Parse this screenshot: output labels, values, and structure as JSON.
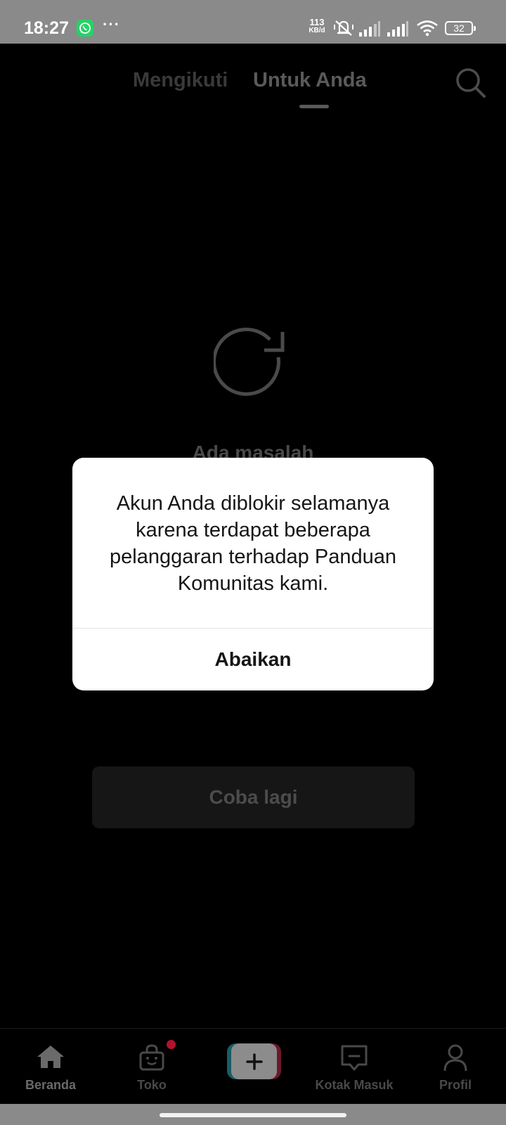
{
  "status_bar": {
    "time": "18:27",
    "notification_icons": [
      "whatsapp-icon",
      "more-dots-icon"
    ],
    "more_indicator": "···",
    "net_speed_value": "113",
    "net_speed_unit": "KB/d",
    "battery_level": "32",
    "system_icons": [
      "mute-vibrate-icon",
      "signal-icon",
      "signal-icon",
      "wifi-icon",
      "battery-icon"
    ]
  },
  "top_nav": {
    "tabs": [
      {
        "label": "Mengikuti",
        "active": false
      },
      {
        "label": "Untuk Anda",
        "active": true
      }
    ],
    "search_icon": "search-icon"
  },
  "error_state": {
    "icon": "refresh-icon",
    "text": "Ada masalah",
    "retry_label": "Coba lagi"
  },
  "dialog": {
    "message": "Akun Anda diblokir selamanya karena terdapat beberapa pelanggaran terhadap Panduan Komunitas kami.",
    "dismiss_label": "Abaikan"
  },
  "bottom_nav": {
    "items": [
      {
        "label": "Beranda",
        "icon": "home-icon",
        "active": true
      },
      {
        "label": "Toko",
        "icon": "shopping-bag-icon",
        "badge": true
      },
      {
        "label": "",
        "icon": "plus-icon"
      },
      {
        "label": "Kotak Masuk",
        "icon": "inbox-icon"
      },
      {
        "label": "Profil",
        "icon": "profile-icon"
      }
    ]
  },
  "colors": {
    "background": "#000000",
    "status_bar": "#8a8a8a",
    "dialog": "#ffffff",
    "badge": "#b3122f",
    "create_left": "#1a5c63",
    "create_right": "#6b1a2b"
  }
}
